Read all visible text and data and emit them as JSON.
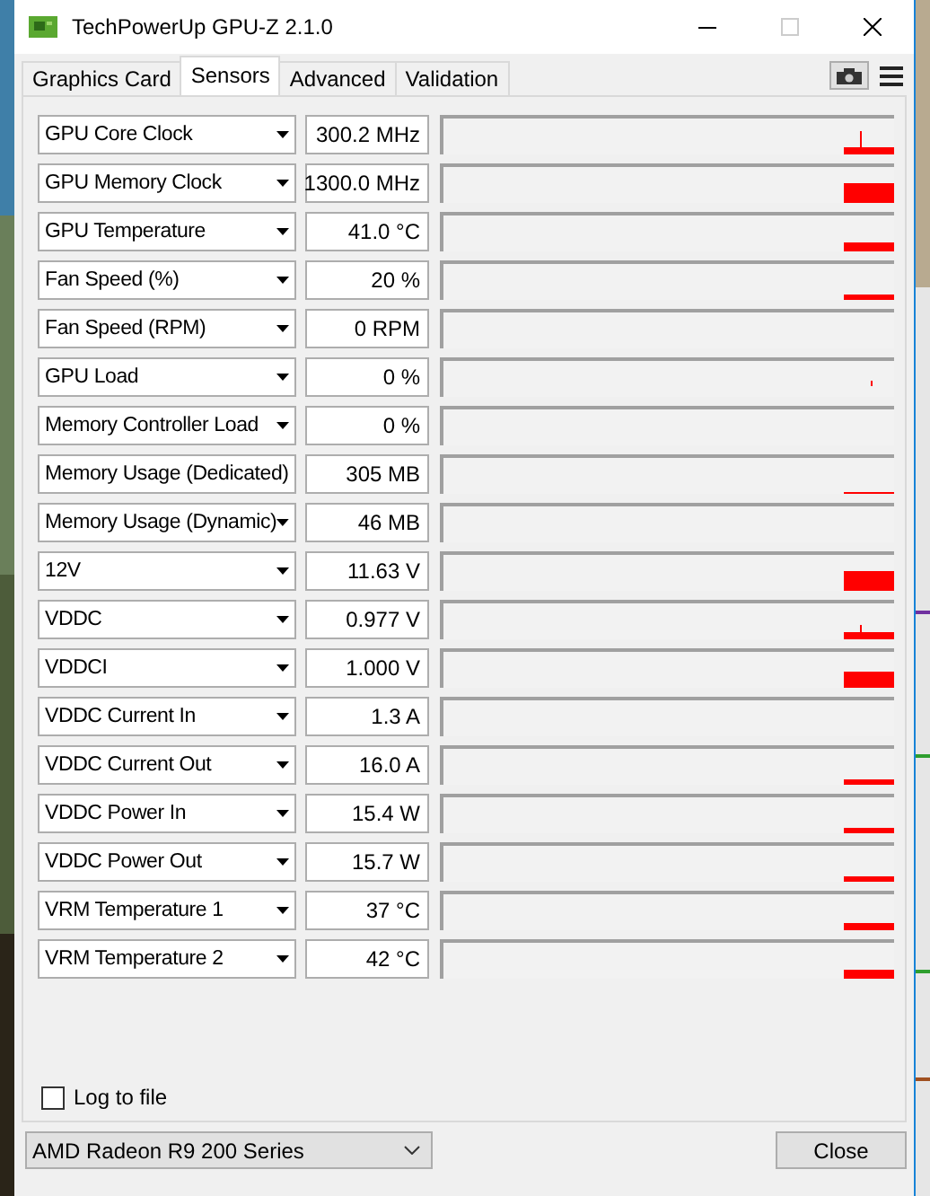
{
  "window": {
    "title": "TechPowerUp GPU-Z 2.1.0"
  },
  "tabs": [
    {
      "label": "Graphics Card",
      "selected": false
    },
    {
      "label": "Sensors",
      "selected": true
    },
    {
      "label": "Advanced",
      "selected": false
    },
    {
      "label": "Validation",
      "selected": false
    }
  ],
  "sensors": [
    {
      "name": "GPU Core Clock",
      "value": "300.2 MHz"
    },
    {
      "name": "GPU Memory Clock",
      "value": "1300.0 MHz"
    },
    {
      "name": "GPU Temperature",
      "value": "41.0 °C"
    },
    {
      "name": "Fan Speed (%)",
      "value": "20 %"
    },
    {
      "name": "Fan Speed (RPM)",
      "value": "0 RPM"
    },
    {
      "name": "GPU Load",
      "value": "0 %"
    },
    {
      "name": "Memory Controller Load",
      "value": "0 %"
    },
    {
      "name": "Memory Usage (Dedicated)",
      "value": "305 MB"
    },
    {
      "name": "Memory Usage (Dynamic)",
      "value": "46 MB"
    },
    {
      "name": "12V",
      "value": "11.63 V"
    },
    {
      "name": "VDDC",
      "value": "0.977 V"
    },
    {
      "name": "VDDCI",
      "value": "1.000 V"
    },
    {
      "name": "VDDC Current In",
      "value": "1.3 A"
    },
    {
      "name": "VDDC Current Out",
      "value": "16.0 A"
    },
    {
      "name": "VDDC Power In",
      "value": "15.4 W"
    },
    {
      "name": "VDDC Power Out",
      "value": "15.7 W"
    },
    {
      "name": "VRM Temperature 1",
      "value": "37 °C"
    },
    {
      "name": "VRM Temperature 2",
      "value": "42 °C"
    }
  ],
  "log_to_file": {
    "label": "Log to file",
    "checked": false
  },
  "device_select": {
    "value": "AMD Radeon R9 200 Series"
  },
  "close_button": {
    "label": "Close"
  }
}
